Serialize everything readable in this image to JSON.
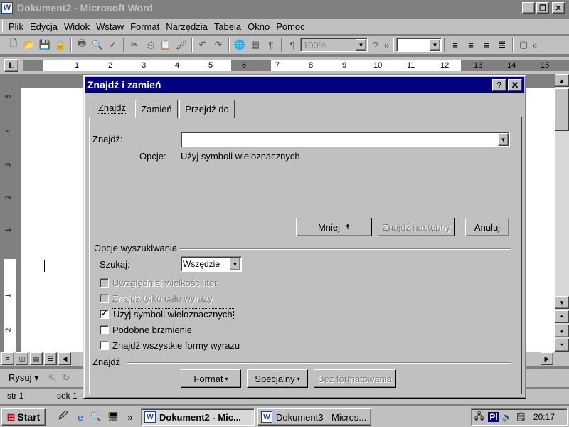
{
  "window": {
    "title": "Dokument2 - Microsoft Word",
    "icon": "W"
  },
  "menu": [
    "Plik",
    "Edycja",
    "Widok",
    "Wstaw",
    "Format",
    "Narzędzia",
    "Tabela",
    "Okno",
    "Pomoc"
  ],
  "toolbar": {
    "zoom": "100%"
  },
  "ruler": {
    "corner": "L",
    "numbers": [
      "1",
      "2",
      "3",
      "4",
      "5",
      "6",
      "7",
      "8",
      "9",
      "10",
      "11",
      "12",
      "13",
      "14",
      "15"
    ]
  },
  "vruler": {
    "numbers": [
      "5",
      "4",
      "3",
      "2",
      "1",
      "1",
      "2"
    ]
  },
  "drawbar": {
    "draw_label": "Rysuj"
  },
  "statusbar": {
    "page": "str 1",
    "section": "sek 1"
  },
  "dialog": {
    "title": "Znajdź i zamień",
    "help": "?",
    "close": "✕",
    "tabs": [
      "Znajdź",
      "Zamień",
      "Przejdź do"
    ],
    "find_label": "Znajdź:",
    "find_value": "",
    "options_label": "Opcje:",
    "options_value": "Użyj symboli wieloznacznych",
    "less_button": "Mniej",
    "less_icon_glyph": "⯭",
    "find_next_button": "Znajdź następny",
    "cancel_button": "Anuluj",
    "search_options_group": "Opcje wyszukiwania",
    "search_label": "Szukaj:",
    "search_value": "Wszędzie",
    "checkboxes": [
      {
        "label": "Uwzględniaj wielkość liter",
        "checked": false,
        "enabled": false
      },
      {
        "label": "Znajdź tylko całe wyrazy",
        "checked": false,
        "enabled": false
      },
      {
        "label": "Użyj symboli wieloznacznych",
        "checked": true,
        "enabled": true
      },
      {
        "label": "Podobne brzmienie",
        "checked": false,
        "enabled": true
      },
      {
        "label": "Znajdź wszystkie formy wyrazu",
        "checked": false,
        "enabled": true
      }
    ],
    "find_group": "Znajdź",
    "format_button": "Format",
    "special_button": "Specjalny",
    "no_format_button": "Bez formatowania"
  },
  "taskbar": {
    "start": "Start",
    "items": [
      "Dokument2 - Mic...",
      "Dokument3 - Micros..."
    ],
    "lang": "Pl",
    "time": "20:17"
  }
}
